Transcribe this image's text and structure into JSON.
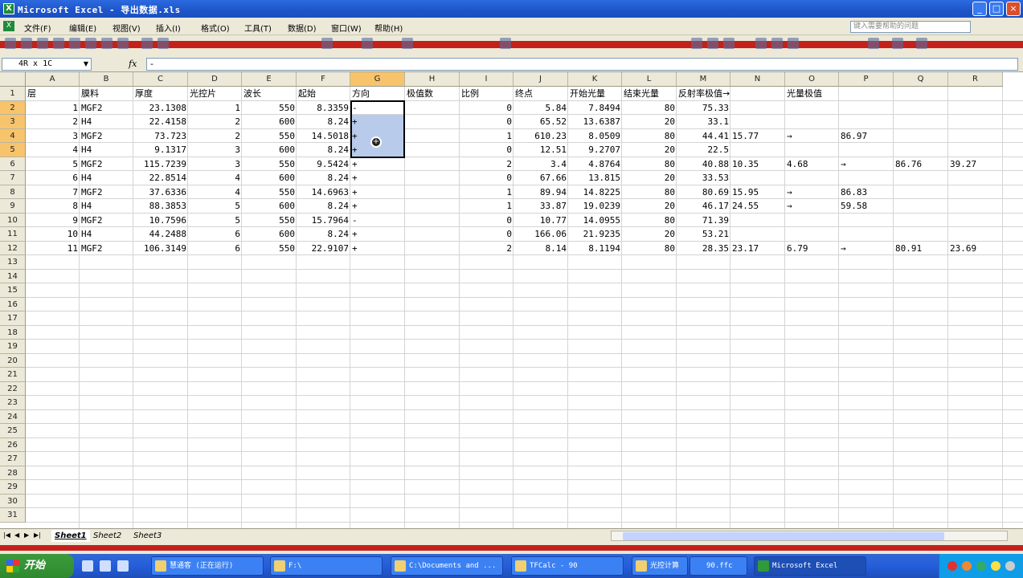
{
  "window": {
    "title": "Microsoft Excel - 导出数据.xls"
  },
  "menu": [
    "文件(F)",
    "编辑(E)",
    "视图(V)",
    "插入(I)",
    "格式(O)",
    "工具(T)",
    "数据(D)",
    "窗口(W)",
    "帮助(H)"
  ],
  "help_placeholder": "键入需要帮助的问题",
  "formula": {
    "name_box": "4R x 1C",
    "fx": "fx",
    "content": "-"
  },
  "columns": [
    "A",
    "B",
    "C",
    "D",
    "E",
    "F",
    "G",
    "H",
    "I",
    "J",
    "K",
    "L",
    "M",
    "N",
    "O",
    "P",
    "Q",
    "R"
  ],
  "selected_column": "G",
  "rows": [
    "1",
    "2",
    "3",
    "4",
    "5",
    "6",
    "7",
    "8",
    "9",
    "10",
    "11",
    "12",
    "13",
    "14",
    "15",
    "16",
    "17",
    "18",
    "19",
    "20",
    "21",
    "22",
    "23",
    "24",
    "25",
    "26",
    "27",
    "28",
    "29",
    "30",
    "31"
  ],
  "header_row": [
    "层",
    "膜料",
    "厚度",
    "光控片",
    "波长",
    "起始",
    "方向",
    "极值数",
    "比例",
    "终点",
    "开始光量",
    "结束光量",
    "反射率极值→",
    "",
    "光量极值",
    "",
    "",
    ""
  ],
  "data_rows": [
    [
      "1",
      "MGF2",
      "23.1308",
      "1",
      "550",
      "8.3359",
      "-",
      "",
      "0",
      "5.84",
      "7.8494",
      "80",
      "75.33",
      "",
      "",
      "",
      ""
    ],
    [
      "2",
      "H4",
      "22.4158",
      "2",
      "600",
      "8.24",
      "+",
      "",
      "0",
      "65.52",
      "13.6387",
      "20",
      "33.1",
      "",
      "",
      "",
      ""
    ],
    [
      "3",
      "MGF2",
      "73.723",
      "2",
      "550",
      "14.5018",
      "+",
      "",
      "1",
      "610.23",
      "8.0509",
      "80",
      "44.41",
      "15.77",
      "→",
      "86.97",
      ""
    ],
    [
      "4",
      "H4",
      "9.1317",
      "3",
      "600",
      "8.24",
      "+",
      "",
      "0",
      "12.51",
      "9.2707",
      "20",
      "22.5",
      "",
      "",
      "",
      ""
    ],
    [
      "5",
      "MGF2",
      "115.7239",
      "3",
      "550",
      "9.5424",
      "+",
      "",
      "2",
      "3.4",
      "4.8764",
      "80",
      "40.88",
      "10.35",
      "4.68",
      "→",
      "86.76",
      "39.27"
    ],
    [
      "6",
      "H4",
      "22.8514",
      "4",
      "600",
      "8.24",
      "+",
      "",
      "0",
      "67.66",
      "13.815",
      "20",
      "33.53",
      "",
      "",
      "",
      ""
    ],
    [
      "7",
      "MGF2",
      "37.6336",
      "4",
      "550",
      "14.6963",
      "+",
      "",
      "1",
      "89.94",
      "14.8225",
      "80",
      "80.69",
      "15.95",
      "→",
      "86.83",
      ""
    ],
    [
      "8",
      "H4",
      "88.3853",
      "5",
      "600",
      "8.24",
      "+",
      "",
      "1",
      "33.87",
      "19.0239",
      "20",
      "46.17",
      "24.55",
      "→",
      "59.58",
      ""
    ],
    [
      "9",
      "MGF2",
      "10.7596",
      "5",
      "550",
      "15.7964",
      "-",
      "",
      "0",
      "10.77",
      "14.0955",
      "80",
      "71.39",
      "",
      "",
      "",
      ""
    ],
    [
      "10",
      "H4",
      "44.2488",
      "6",
      "600",
      "8.24",
      "+",
      "",
      "0",
      "166.06",
      "21.9235",
      "20",
      "53.21",
      "",
      "",
      "",
      ""
    ],
    [
      "11",
      "MGF2",
      "106.3149",
      "6",
      "550",
      "22.9107",
      "+",
      "",
      "2",
      "8.14",
      "8.1194",
      "80",
      "28.35",
      "23.17",
      "6.79",
      "→",
      "80.91",
      "23.69"
    ]
  ],
  "sheets": [
    "Sheet1",
    "Sheet2",
    "Sheet3"
  ],
  "taskbar": {
    "start": "开始",
    "buttons": [
      "慧通客 (正在运行)",
      "F:\\",
      "C:\\Documents and ...",
      "TFCalc - 90",
      "光控计算",
      "90.ffc",
      "Microsoft Excel"
    ]
  }
}
